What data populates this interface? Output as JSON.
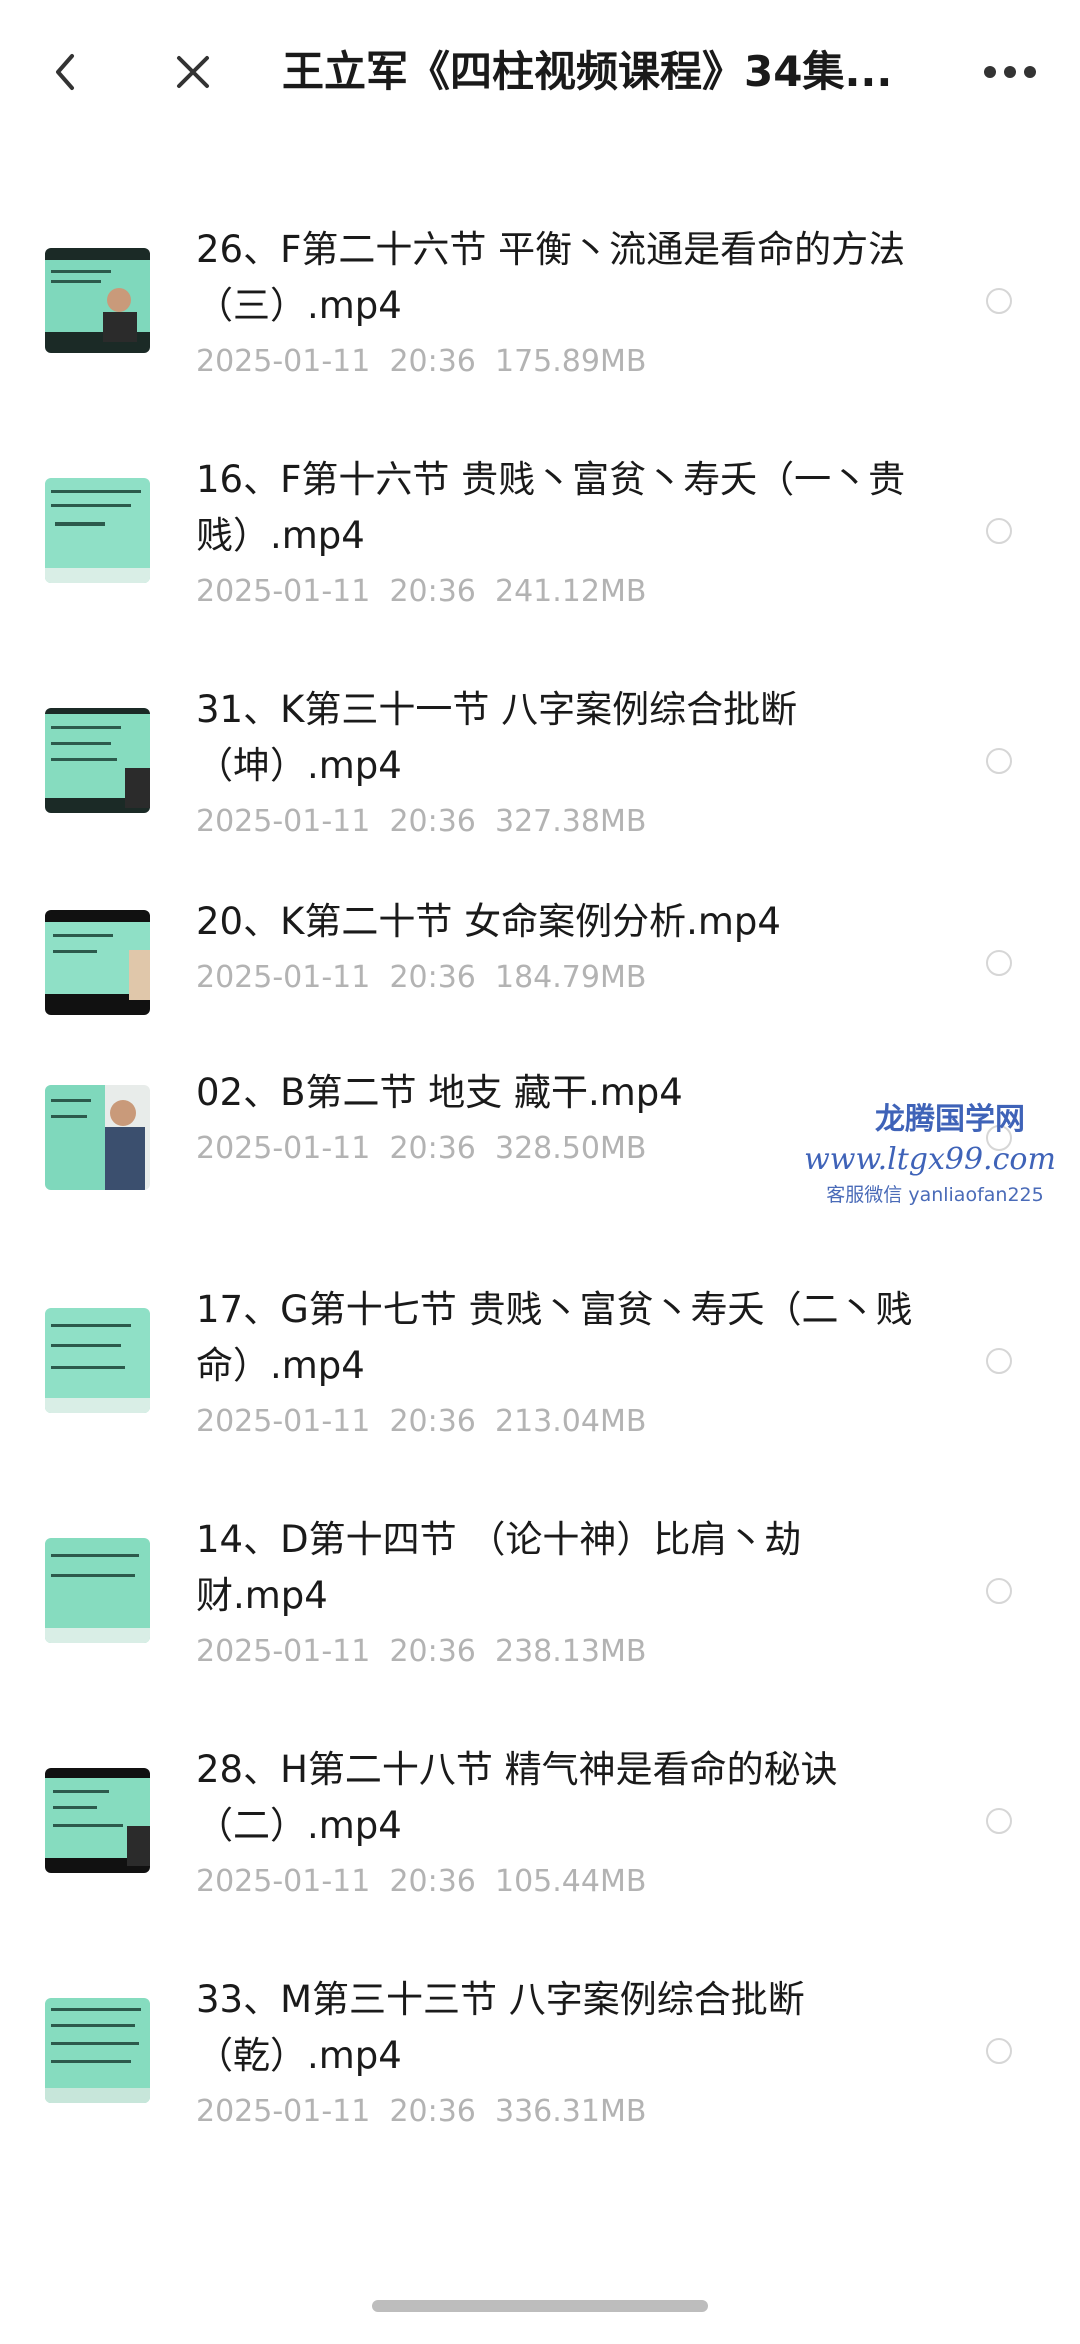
{
  "header": {
    "title": "王立军《四柱视频课程》34集..."
  },
  "files": [
    {
      "title": "26、F第二十六节  平衡丶流通是看命的方法（三）.mp4",
      "date": "2025-01-11",
      "time": "20:36",
      "size": "175.89MB"
    },
    {
      "title": "16、F第十六节 贵贱丶富贫丶寿夭（一丶贵贱）.mp4",
      "date": "2025-01-11",
      "time": "20:36",
      "size": "241.12MB"
    },
    {
      "title": "31、K第三十一节  八字案例综合批断（坤）.mp4",
      "date": "2025-01-11",
      "time": "20:36",
      "size": "327.38MB"
    },
    {
      "title": "20、K第二十节  女命案例分析.mp4",
      "date": "2025-01-11",
      "time": "20:36",
      "size": "184.79MB"
    },
    {
      "title": "02、B第二节 地支 藏干.mp4",
      "date": "2025-01-11",
      "time": "20:36",
      "size": "328.50MB"
    },
    {
      "title": "17、G第十七节 贵贱丶富贫丶寿夭（二丶贱命）.mp4",
      "date": "2025-01-11",
      "time": "20:36",
      "size": "213.04MB"
    },
    {
      "title": "14、D第十四节 （论十神）比肩丶劫财.mp4",
      "date": "2025-01-11",
      "time": "20:36",
      "size": "238.13MB"
    },
    {
      "title": "28、H第二十八节  精气神是看命的秘诀（二）.mp4",
      "date": "2025-01-11",
      "time": "20:36",
      "size": "105.44MB"
    },
    {
      "title": "33、M第三十三节  八字案例综合批断（乾）.mp4",
      "date": "2025-01-11",
      "time": "20:36",
      "size": "336.31MB"
    }
  ],
  "watermark": {
    "line1": "龙腾国学网",
    "line2": "www.ltgx99.com",
    "line3": "客服微信 yanliaofan225"
  }
}
